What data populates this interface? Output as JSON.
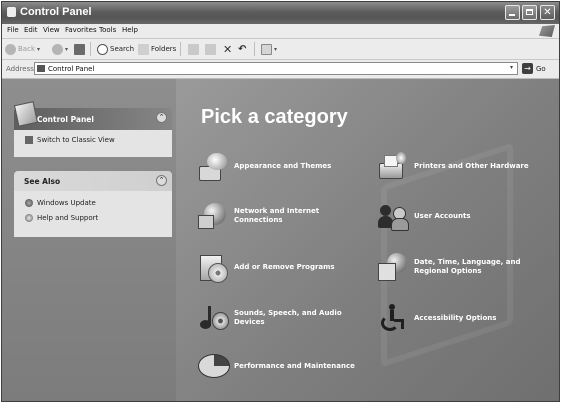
{
  "window": {
    "title": "Control Panel",
    "buttons": {
      "minimize": "",
      "maximize": "",
      "close": "✕"
    }
  },
  "menu": [
    "File",
    "Edit",
    "View",
    "Favorites",
    "Tools",
    "Help"
  ],
  "toolbar": {
    "back": "Back",
    "forward_dropdown": "▾",
    "search": "Search",
    "folders": "Folders",
    "views_dropdown": "▾"
  },
  "address": {
    "label": "Address",
    "value": "Control Panel",
    "go": "Go",
    "go_arrow": "→",
    "dropdown": "▾"
  },
  "task_pane": {
    "control_panel": {
      "title": "Control Panel",
      "collapse": "⌃",
      "link": "Switch to Classic View"
    },
    "see_also": {
      "title": "See Also",
      "collapse": "⌃",
      "links": [
        "Windows Update",
        "Help and Support"
      ]
    }
  },
  "main": {
    "title": "Pick a category",
    "categories": [
      {
        "label": "Appearance and Themes",
        "icon": "appearance-themes-icon"
      },
      {
        "label": "Printers and Other Hardware",
        "icon": "printers-hardware-icon"
      },
      {
        "label": "Network and Internet Connections",
        "icon": "network-internet-icon"
      },
      {
        "label": "User Accounts",
        "icon": "user-accounts-icon"
      },
      {
        "label": "Add or Remove Programs",
        "icon": "add-remove-programs-icon"
      },
      {
        "label": "Date, Time, Language, and Regional Options",
        "icon": "date-time-language-icon"
      },
      {
        "label": "Sounds, Speech, and Audio Devices",
        "icon": "sounds-audio-icon"
      },
      {
        "label": "Accessibility Options",
        "icon": "accessibility-icon"
      },
      {
        "label": "Performance and Maintenance",
        "icon": "performance-maintenance-icon"
      }
    ]
  }
}
